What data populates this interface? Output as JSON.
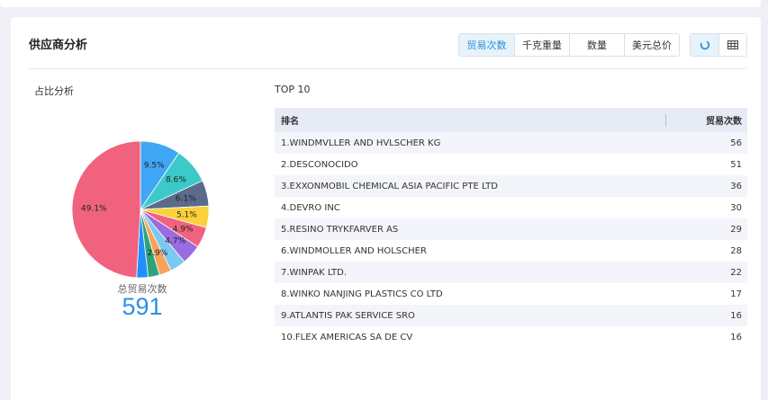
{
  "panel": {
    "title": "供应商分析"
  },
  "metric_tabs": [
    {
      "label": "贸易次数",
      "active": true
    },
    {
      "label": "千克重量",
      "active": false
    },
    {
      "label": "数量",
      "active": false
    },
    {
      "label": "美元总价",
      "active": false
    }
  ],
  "view_toggle": {
    "pie_icon": "pie-chart-icon",
    "table_icon": "table-icon",
    "active": "pie"
  },
  "share_section": {
    "title": "占比分析"
  },
  "top10_section": {
    "title": "TOP 10"
  },
  "pie": {
    "total_label": "总贸易次数",
    "total_value": "591",
    "slices": [
      {
        "value": 9.5,
        "label": "9.5%",
        "color": "#3fa7f5"
      },
      {
        "value": 8.6,
        "label": "8.6%",
        "color": "#3cc9c9"
      },
      {
        "value": 6.1,
        "label": "6.1%",
        "color": "#5a6b8c"
      },
      {
        "value": 5.1,
        "label": "5.1%",
        "color": "#fcd13a"
      },
      {
        "value": 4.9,
        "label": "4.9%",
        "color": "#f0627e"
      },
      {
        "value": 4.7,
        "label": "4.7%",
        "color": "#9a6ce0"
      },
      {
        "value": 3.7,
        "label": "",
        "color": "#7bc9f2"
      },
      {
        "value": 2.9,
        "label": "2.9%",
        "color": "#f7a35c"
      },
      {
        "value": 2.7,
        "label": "",
        "color": "#2ea37b"
      },
      {
        "value": 2.7,
        "label": "",
        "color": "#1e90ff"
      },
      {
        "value": 49.1,
        "label": "49.1%",
        "color": "#f0627e"
      }
    ]
  },
  "table": {
    "headers": {
      "rank": "排名",
      "count": "贸易次数"
    },
    "rows": [
      {
        "name": "1.WINDMVLLER AND HVLSCHER KG",
        "count": "56"
      },
      {
        "name": "2.DESCONOCIDO",
        "count": "51"
      },
      {
        "name": "3.EXXONMOBIL CHEMICAL ASIA PACIFIC PTE LTD",
        "count": "36"
      },
      {
        "name": "4.DEVRO INC",
        "count": "30"
      },
      {
        "name": "5.RESINO TRYKFARVER AS",
        "count": "29"
      },
      {
        "name": "6.WINDMOLLER AND HOLSCHER",
        "count": "28"
      },
      {
        "name": "7.WINPAK LTD.",
        "count": "22"
      },
      {
        "name": "8.WINKO NANJING PLASTICS CO LTD",
        "count": "17"
      },
      {
        "name": "9.ATLANTIS PAK SERVICE SRO",
        "count": "16"
      },
      {
        "name": "10.FLEX AMERICAS SA DE CV",
        "count": "16"
      }
    ]
  }
}
